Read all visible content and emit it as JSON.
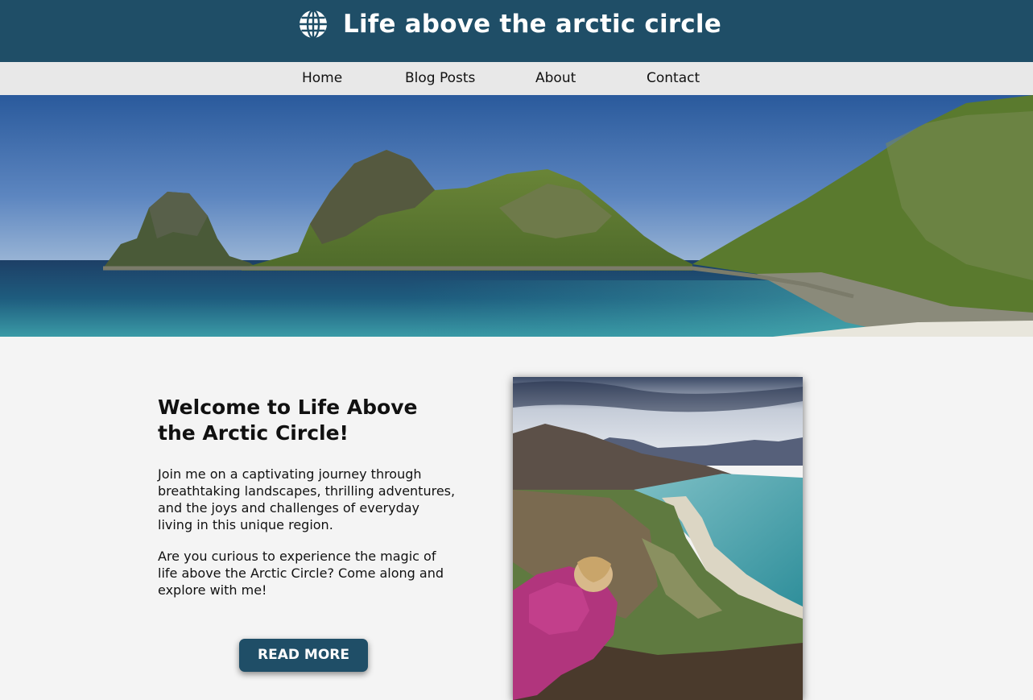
{
  "header": {
    "title": "Life above the arctic circle",
    "logo_icon": "globe-icon",
    "background_color": "#1f4e67"
  },
  "nav": {
    "items": [
      {
        "label": "Home"
      },
      {
        "label": "Blog Posts"
      },
      {
        "label": "About"
      },
      {
        "label": "Contact"
      }
    ],
    "background_color": "#e8e8e8"
  },
  "hero": {
    "image": "arctic-coast-landscape"
  },
  "intro": {
    "heading": "Welcome to Life Above the Arctic Circle!",
    "paragraph_1": "Join me on a captivating journey through breathtaking landscapes, thrilling adventures, and the joys and challenges of everyday living in this unique region.",
    "paragraph_2": "Are you curious to experience the magic of life above the Arctic Circle? Come along and explore with me!",
    "button_label": "READ MORE",
    "button_color": "#1f4e67"
  },
  "feature_photo": {
    "image": "person-overlooking-beach"
  }
}
